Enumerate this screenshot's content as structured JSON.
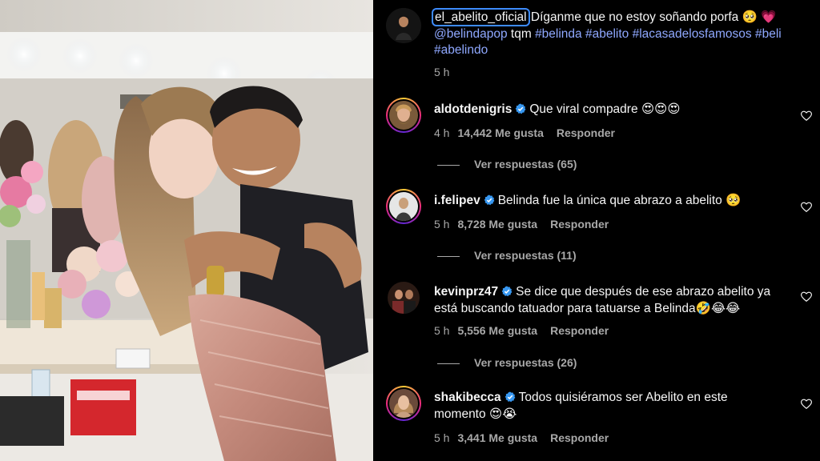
{
  "post": {
    "author": "el_abelito_oficial",
    "caption_text": "Díganme que no estoy soñando porfa 🥺 💗",
    "caption_mentions": "@belindapop",
    "caption_plain": "tqm",
    "caption_hashtags_line1": "#belinda #abelito #lacasadelosfamosos",
    "caption_hashtags_line2": "#beli #abelindo",
    "time": "5 h"
  },
  "comments": [
    {
      "username": "aldotdenigris",
      "verified": true,
      "text": "Que viral compadre 😍😍😍",
      "time": "4 h",
      "likes": "14,442 Me gusta",
      "reply_label": "Responder",
      "view_replies": "Ver respuestas (65)"
    },
    {
      "username": "i.felipev",
      "verified": true,
      "text": "Belinda fue la única que abrazo a abelito 🥺",
      "time": "5 h",
      "likes": "8,728 Me gusta",
      "reply_label": "Responder",
      "view_replies": "Ver respuestas (11)"
    },
    {
      "username": "kevinprz47",
      "verified": true,
      "text": "Se dice que después de ese abrazo abelito ya está buscando tatuador para tatuarse a Belinda🤣😂😂",
      "time": "5 h",
      "likes": "5,556 Me gusta",
      "reply_label": "Responder",
      "view_replies": "Ver respuestas (26)"
    },
    {
      "username": "shakibecca",
      "verified": true,
      "text": "Todos quisiéramos ser Abelito en este momento 😍😭",
      "time": "5 h",
      "likes": "3,441 Me gusta",
      "reply_label": "Responder"
    }
  ],
  "colors": {
    "background": "#000000",
    "text": "#f5f5f5",
    "secondary_text": "#a8a8a8",
    "link": "#8fa8ff",
    "verified": "#3797f0",
    "focus_outline": "#3d8bfd"
  },
  "icons": [
    "verified-badge-icon",
    "heart-outline-icon"
  ]
}
